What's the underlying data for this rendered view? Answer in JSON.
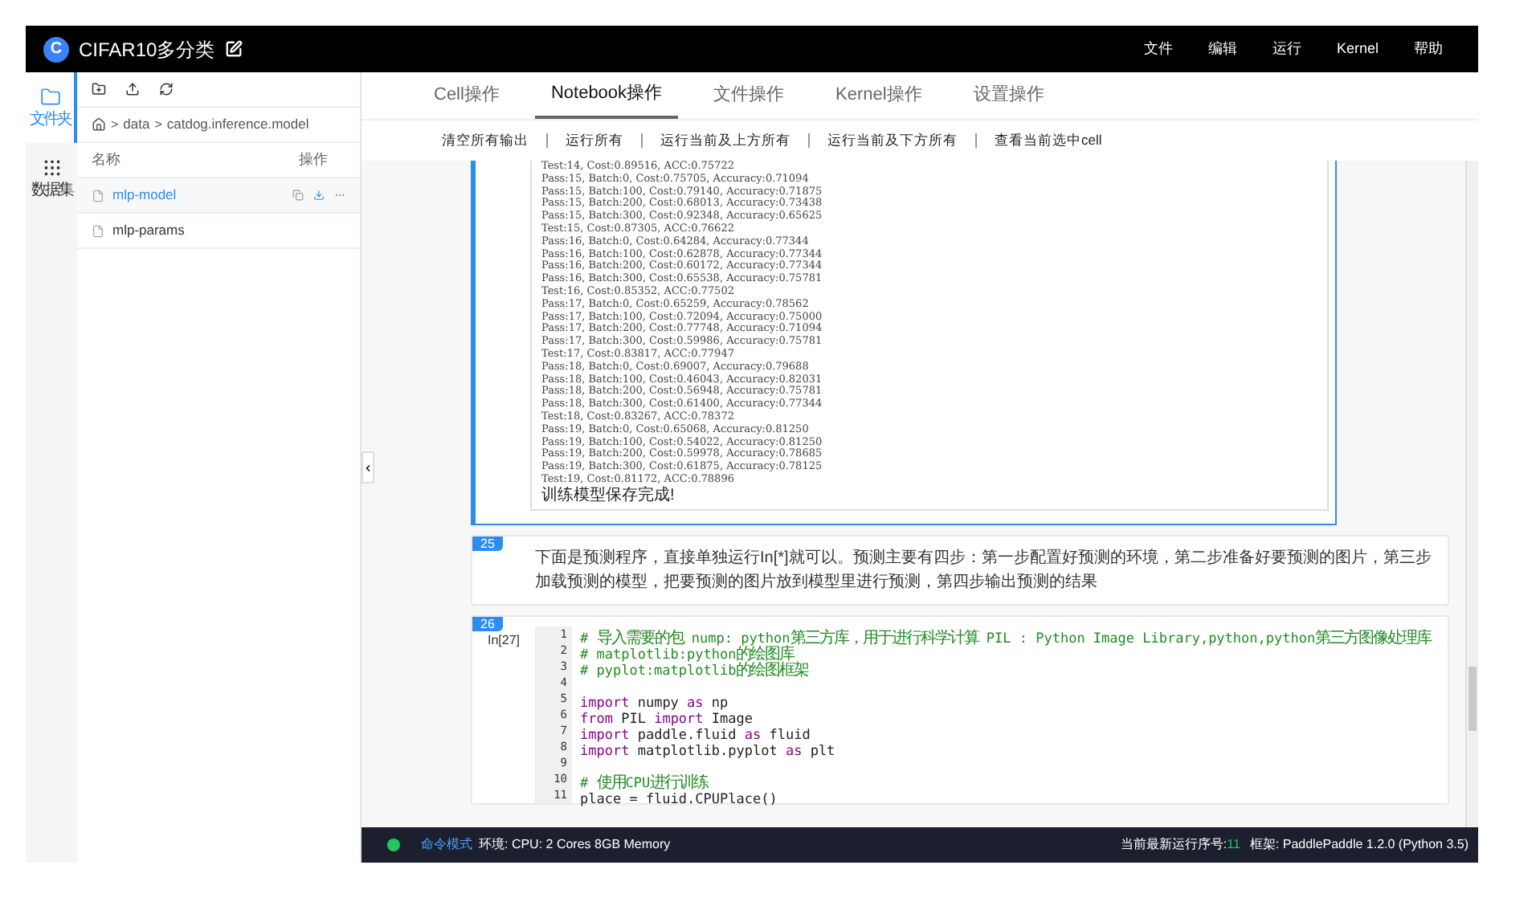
{
  "header": {
    "logo_letter": "C",
    "title": "CIFAR10多分类",
    "menu": [
      "文件",
      "编辑",
      "运行",
      "Kernel",
      "帮助"
    ]
  },
  "nav": [
    {
      "label": "文件夹",
      "kind": "folder",
      "selected": true
    },
    {
      "label": "数据集",
      "kind": "dataset",
      "selected": false
    }
  ],
  "file_panel": {
    "breadcrumb": [
      "data",
      "catdog.inference.model"
    ],
    "separator": ">",
    "columns": [
      "名称",
      "操作"
    ],
    "files": [
      {
        "name": "mlp-model",
        "selected": true
      },
      {
        "name": "mlp-params",
        "selected": false
      }
    ]
  },
  "tabs": [
    {
      "label": "Cell操作",
      "selected": false
    },
    {
      "label": "Notebook操作",
      "selected": true
    },
    {
      "label": "文件操作",
      "selected": false
    },
    {
      "label": "Kernel操作",
      "selected": false
    },
    {
      "label": "设置操作",
      "selected": false
    }
  ],
  "actions": [
    "清空所有输出",
    "运行所有",
    "运行当前及上方所有",
    "运行当前及下方所有",
    "查看当前选中cell"
  ],
  "cells": [
    {
      "kind": "output",
      "selected": true,
      "lines": [
        "Test:14, Cost:0.89516, ACC:0.75722",
        "Pass:15, Batch:0, Cost:0.75705, Accuracy:0.71094",
        "Pass:15, Batch:100, Cost:0.79140, Accuracy:0.71875",
        "Pass:15, Batch:200, Cost:0.68013, Accuracy:0.73438",
        "Pass:15, Batch:300, Cost:0.92348, Accuracy:0.65625",
        "Test:15, Cost:0.87305, ACC:0.76622",
        "Pass:16, Batch:0, Cost:0.64284, Accuracy:0.77344",
        "Pass:16, Batch:100, Cost:0.62878, Accuracy:0.77344",
        "Pass:16, Batch:200, Cost:0.60172, Accuracy:0.77344",
        "Pass:16, Batch:300, Cost:0.65538, Accuracy:0.75781",
        "Test:16, Cost:0.85352, ACC:0.77502",
        "Pass:17, Batch:0, Cost:0.65259, Accuracy:0.78562",
        "Pass:17, Batch:100, Cost:0.72094, Accuracy:0.75000",
        "Pass:17, Batch:200, Cost:0.77748, Accuracy:0.71094",
        "Pass:17, Batch:300, Cost:0.59986, Accuracy:0.75781",
        "Test:17, Cost:0.83817, ACC:0.77947",
        "Pass:18, Batch:0, Cost:0.69007, Accuracy:0.79688",
        "Pass:18, Batch:100, Cost:0.46043, Accuracy:0.82031",
        "Pass:18, Batch:200, Cost:0.56948, Accuracy:0.75781",
        "Pass:18, Batch:300, Cost:0.61400, Accuracy:0.77344",
        "Test:18, Cost:0.83267, ACC:0.78372",
        "Pass:19, Batch:0, Cost:0.65068, Accuracy:0.81250",
        "Pass:19, Batch:100, Cost:0.54022, Accuracy:0.81250",
        "Pass:19, Batch:200, Cost:0.59978, Accuracy:0.78685",
        "Pass:19, Batch:300, Cost:0.61875, Accuracy:0.78125",
        "Test:19, Cost:0.81172, ACC:0.78896"
      ],
      "message": "训练模型保存完成!"
    },
    {
      "kind": "markdown",
      "selected": false,
      "number": "25",
      "text": "下面是预测程序，直接单独运行In[*]就可以。预测主要有四步：第一步配置好预测的环境，第二步准备好要预测的图片，第三步加载预测的模型，把要预测的图片放到模型里进行预测，第四步输出预测的结果"
    },
    {
      "kind": "code",
      "selected": false,
      "number": "26",
      "prompt": "In[27]",
      "lines": [
        {
          "num": "1",
          "segments": [
            {
              "kind": "comment",
              "text": "# 导入需要的包 nump: python第三方库，用于进行科学计算 PIL : Python Image Library,python,python第三方图像处理库"
            }
          ]
        },
        {
          "num": "2",
          "segments": [
            {
              "kind": "comment",
              "text": "# matplotlib:python的绘图库"
            }
          ]
        },
        {
          "num": "3",
          "segments": [
            {
              "kind": "comment",
              "text": "# pyplot:matplotlib的绘图框架"
            }
          ]
        },
        {
          "num": "4"
        },
        {
          "num": "5",
          "segments": [
            {
              "kind": "keyword",
              "text": "import"
            },
            {
              "kind": "plain",
              "text": " numpy "
            },
            {
              "kind": "keyword",
              "text": "as"
            },
            {
              "kind": "plain",
              "text": " np"
            }
          ]
        },
        {
          "num": "6",
          "segments": [
            {
              "kind": "keyword",
              "text": "from"
            },
            {
              "kind": "plain",
              "text": " PIL "
            },
            {
              "kind": "keyword",
              "text": "import"
            },
            {
              "kind": "plain",
              "text": " Image"
            }
          ]
        },
        {
          "num": "7",
          "segments": [
            {
              "kind": "keyword",
              "text": "import"
            },
            {
              "kind": "plain",
              "text": " paddle.fluid "
            },
            {
              "kind": "keyword",
              "text": "as"
            },
            {
              "kind": "plain",
              "text": " fluid"
            }
          ]
        },
        {
          "num": "8",
          "segments": [
            {
              "kind": "keyword",
              "text": "import"
            },
            {
              "kind": "plain",
              "text": " matplotlib.pyplot "
            },
            {
              "kind": "keyword",
              "text": "as"
            },
            {
              "kind": "plain",
              "text": " plt"
            }
          ]
        },
        {
          "num": "9"
        },
        {
          "num": "10",
          "segments": [
            {
              "kind": "comment",
              "text": "# 使用CPU进行训练"
            }
          ]
        },
        {
          "num": "11",
          "segments": [
            {
              "kind": "plain",
              "text": "place = fluid.CPUPlace()"
            }
          ]
        }
      ]
    }
  ],
  "status_bar": {
    "mode": "命令模式",
    "environment": "环境: CPU: 2 Cores 8GB Memory",
    "run_label": "当前最新运行序号:",
    "run_number": "11",
    "framework": "框架: PaddlePaddle 1.2.0 (Python 3.5)"
  }
}
